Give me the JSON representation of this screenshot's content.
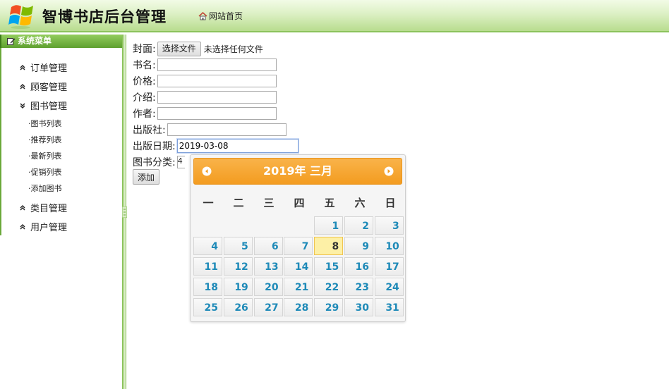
{
  "header": {
    "title": "智博书店后台管理",
    "home_link": "网站首页"
  },
  "sidebar": {
    "title": "系统菜单",
    "menu": [
      {
        "label": "订单管理",
        "expanded": false
      },
      {
        "label": "顾客管理",
        "expanded": false
      },
      {
        "label": "图书管理",
        "expanded": true
      },
      {
        "label": "类目管理",
        "expanded": false
      },
      {
        "label": "用户管理",
        "expanded": false
      }
    ],
    "book_submenu": [
      "·图书列表",
      "·推荐列表",
      "·最新列表",
      "·促销列表",
      "·添加图书"
    ]
  },
  "form": {
    "cover_label": "封面:",
    "file_button": "选择文件",
    "file_status": "未选择任何文件",
    "name_label": "书名:",
    "price_label": "价格:",
    "intro_label": "介绍:",
    "author_label": "作者:",
    "publisher_label": "出版社:",
    "pubdate_label": "出版日期:",
    "pubdate_value": "2019-03-08",
    "category_label": "图书分类:",
    "category_value": "4",
    "submit_label": "添加"
  },
  "datepicker": {
    "title": "2019年 三月",
    "weekdays": [
      "一",
      "二",
      "三",
      "四",
      "五",
      "六",
      "日"
    ],
    "weeks": [
      [
        "",
        "",
        "",
        "",
        "1",
        "2",
        "3"
      ],
      [
        "4",
        "5",
        "6",
        "7",
        "8",
        "9",
        "10"
      ],
      [
        "11",
        "12",
        "13",
        "14",
        "15",
        "16",
        "17"
      ],
      [
        "18",
        "19",
        "20",
        "21",
        "22",
        "23",
        "24"
      ],
      [
        "25",
        "26",
        "27",
        "28",
        "29",
        "30",
        "31"
      ]
    ],
    "selected_day": "8",
    "colors": {
      "header": "#f39c20",
      "day": "#1e8ab8",
      "today_bg": "#fdf0a6"
    }
  }
}
